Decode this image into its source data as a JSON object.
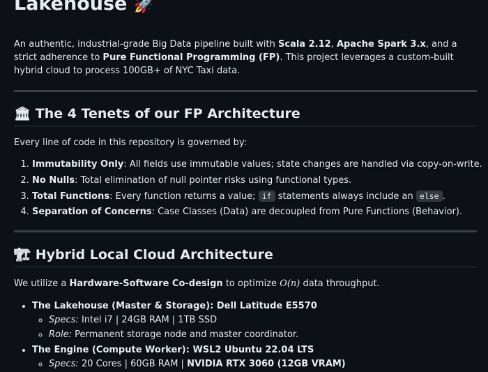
{
  "title": {
    "text": "Lakehouse",
    "emoji": "🚀"
  },
  "intro": {
    "t1": "An authentic, industrial-grade Big Data pipeline built with ",
    "b1": "Scala 2.12",
    "t2": ", ",
    "b2": "Apache Spark 3.x",
    "t3": ", and a strict adherence to ",
    "b3": "Pure Functional Programming (FP)",
    "t4": ". This project leverages a custom-built hybrid cloud to process 100GB+ of NYC Taxi data."
  },
  "tenets": {
    "heading_emoji": "🏛",
    "heading": "The 4 Tenets of our FP Architecture",
    "lead": "Every line of code in this repository is governed by:",
    "items": [
      {
        "bold": "Immutability Only",
        "text": ": All fields use immutable values; state changes are handled via copy-on-write."
      },
      {
        "bold": "No Nulls",
        "text": ": Total elimination of null pointer risks using functional types."
      },
      {
        "bold": "Total Functions",
        "text": ": Every function returns a value; ",
        "code1": "if",
        "text2": " statements always include an ",
        "code2": "else",
        "text3": "."
      },
      {
        "bold": "Separation of Concerns",
        "text": ": Case Classes (Data) are decoupled from Pure Functions (Behavior)."
      }
    ]
  },
  "cloud": {
    "heading_emoji": "🏗",
    "heading": "Hybrid Local Cloud Architecture",
    "lead_t1": "We utilize a ",
    "lead_b": "Hardware-Software Co-design",
    "lead_t2": " to optimize ",
    "lead_math": "O(n)",
    "lead_t3": " data throughput.",
    "nodes": [
      {
        "name": "The Lakehouse (Master & Storage): Dell Latitude E5570",
        "specs_label": "Specs:",
        "specs_text": " Intel i7 | 24GB RAM | 1TB SSD",
        "role_label": "Role:",
        "role_text": " Permanent storage node and master coordinator."
      },
      {
        "name": "The Engine (Compute Worker): WSL2 Ubuntu 22.04 LTS",
        "specs_label": "Specs:",
        "specs_text": " 20 Cores | 60GB RAM | ",
        "specs_bold": "NVIDIA RTX 3060 (12GB VRAM)"
      }
    ]
  }
}
